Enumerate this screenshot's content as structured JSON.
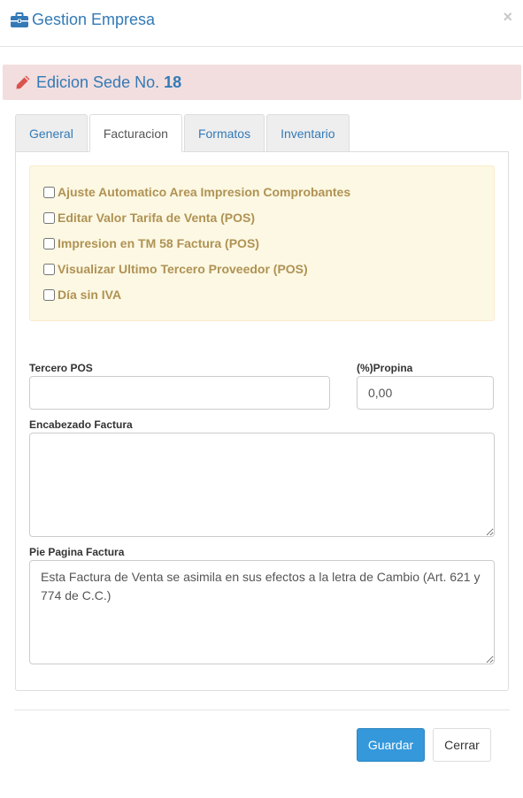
{
  "header": {
    "title": "Gestion Empresa",
    "close_label": "×",
    "icon": "briefcase-icon"
  },
  "alert": {
    "prefix": "Edicion Sede No.",
    "sede_number": "18",
    "icon": "pencil-icon"
  },
  "tabs": [
    {
      "label": "General"
    },
    {
      "label": "Facturacion"
    },
    {
      "label": "Formatos"
    },
    {
      "label": "Inventario"
    }
  ],
  "active_tab": "Facturacion",
  "options": [
    {
      "label": "Ajuste Automatico Area Impresion Comprobantes",
      "checked": false
    },
    {
      "label": "Editar Valor Tarifa de Venta (POS)",
      "checked": false
    },
    {
      "label": "Impresion en TM 58 Factura (POS)",
      "checked": false
    },
    {
      "label": "Visualizar Ultimo Tercero Proveedor (POS)",
      "checked": false
    },
    {
      "label": "Día sin IVA",
      "checked": false
    }
  ],
  "form": {
    "tercero_pos": {
      "label": "Tercero POS",
      "value": ""
    },
    "propina": {
      "label": "(%)Propina",
      "value": "0,00"
    },
    "encabezado": {
      "label": "Encabezado Factura",
      "value": ""
    },
    "pie_pagina": {
      "label": "Pie Pagina Factura",
      "value": "Esta Factura de Venta se asimila en sus efectos a la letra de Cambio (Art. 621 y 774 de C.C.)"
    }
  },
  "footer": {
    "save_label": "Guardar",
    "close_label": "Cerrar"
  },
  "colors": {
    "link": "#337ab7",
    "alert_bg": "#f2dede",
    "warning_bg": "#fcf8e3",
    "warning_text": "#b09254",
    "primary": "#3498db"
  }
}
